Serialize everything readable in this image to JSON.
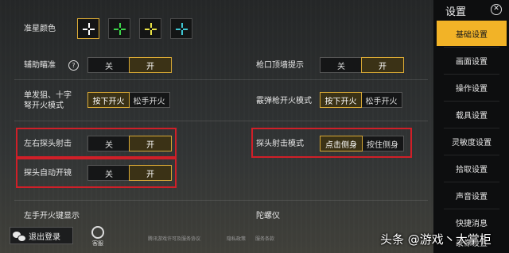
{
  "crosshair": {
    "label": "准星颜色",
    "colors": [
      "#ffffff",
      "#3ed64a",
      "#e8e245",
      "#3ec6d2"
    ]
  },
  "assist_aim": {
    "label": "辅助瞄准",
    "help_glyph": "?",
    "off": "关",
    "on": "开"
  },
  "muzzle_hint": {
    "label": "枪口顶墙提示",
    "off": "关",
    "on": "开"
  },
  "single_fire": {
    "label_line1": "单发狙、十字",
    "label_line2": "弩开火模式",
    "opt1": "按下开火",
    "opt2": "松手开火"
  },
  "shotgun_fire": {
    "label": "霰弹枪开火模式",
    "opt1": "按下开火",
    "opt2": "松手开火"
  },
  "peek_fire": {
    "label": "左右探头射击",
    "off": "关",
    "on": "开"
  },
  "peek_mode": {
    "label": "探头射击模式",
    "opt1": "点击侧身",
    "opt2": "按住侧身"
  },
  "peek_scope": {
    "label": "探头自动开镜",
    "off": "关",
    "on": "开"
  },
  "left_fire_btn": {
    "label": "左手开火键显示"
  },
  "gyro": {
    "label": "陀螺仪"
  },
  "logout_label": "退出登录",
  "service_label": "客服",
  "footer_links": [
    "腾讯游戏许可及服务协议",
    "隐私政策",
    "服务条款"
  ],
  "sidebar": {
    "title": "设置",
    "items": [
      "基础设置",
      "画面设置",
      "操作设置",
      "载具设置",
      "灵敏度设置",
      "拾取设置",
      "声音设置",
      "快捷消息",
      "录像设置"
    ],
    "active_index": 0
  },
  "watermark": "头条 @游戏丶大掌柜"
}
